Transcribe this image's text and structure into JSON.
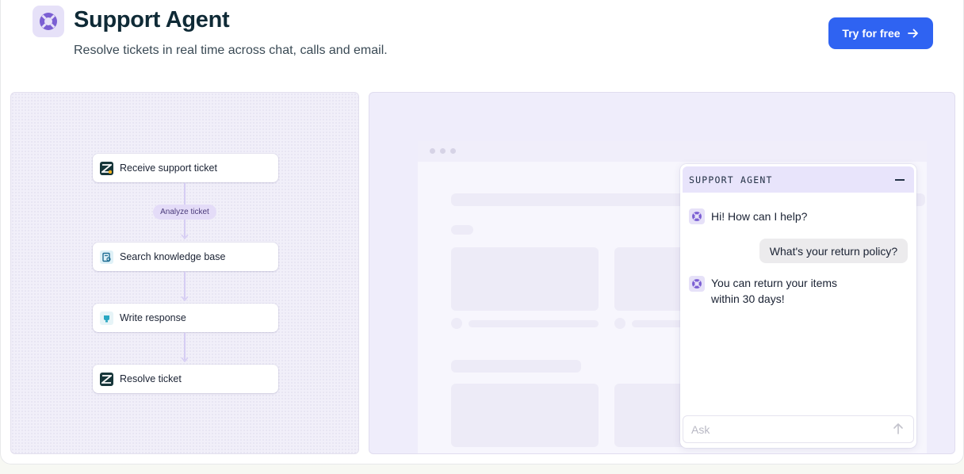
{
  "header": {
    "title": "Support Agent",
    "subtitle": "Resolve tickets in real time across chat, calls and email.",
    "cta_label": "Try for free",
    "logo_icon": "lifebuoy-icon"
  },
  "workflow": {
    "steps": [
      {
        "label": "Receive support ticket",
        "icon": "zendesk-icon"
      },
      {
        "label": "Search knowledge base",
        "icon": "knowledge-base-icon"
      },
      {
        "label": "Write response",
        "icon": "write-icon"
      },
      {
        "label": "Resolve ticket",
        "icon": "zendesk-icon"
      }
    ],
    "analyze_label": "Analyze ticket"
  },
  "chat": {
    "title": "SUPPORT AGENT",
    "messages": [
      {
        "role": "bot",
        "line1": "Hi! How can I help?",
        "line2": ""
      },
      {
        "role": "user",
        "text": "What's your return policy?"
      },
      {
        "role": "bot",
        "line1": "You can return your items",
        "line2": "within 30 days!"
      }
    ],
    "input_placeholder": "Ask"
  },
  "colors": {
    "accent": "#2f63f2",
    "brand_purple": "#7b5fd3",
    "zendesk": "#17363a"
  }
}
